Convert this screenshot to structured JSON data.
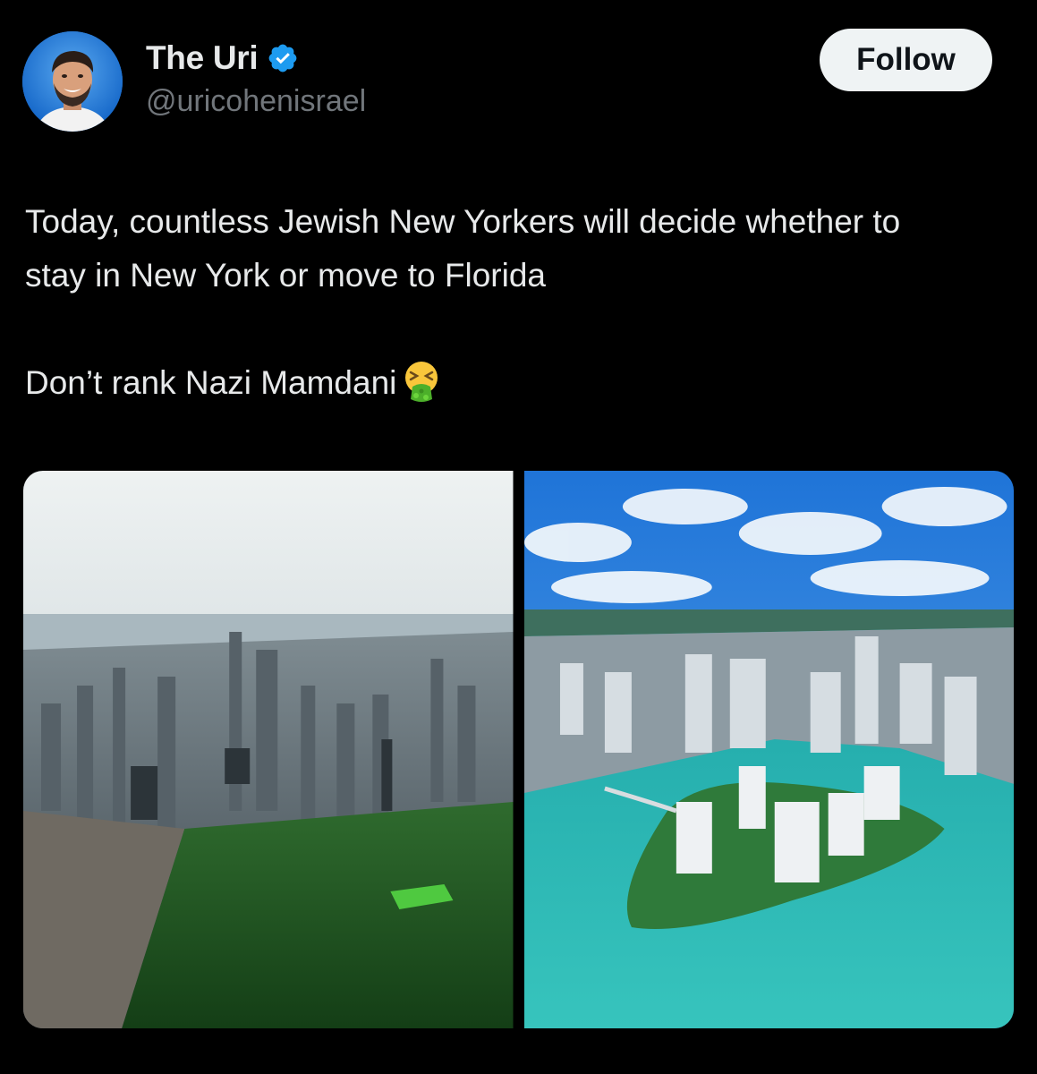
{
  "author": {
    "display_name": "The Uri",
    "handle": "@uricohenisrael",
    "verified": true,
    "avatar_icon": "avatar-icon"
  },
  "follow_label": "Follow",
  "tweet": {
    "line1": "Today, countless Jewish New Yorkers will decide whether to stay in New York or move to Florida",
    "line2": "Don’t rank Nazi Mamdani",
    "emoji": "nauseated-vomiting-face-icon"
  },
  "media": {
    "count": 2,
    "images": [
      "new-york-central-park-image",
      "miami-brickell-key-image"
    ]
  },
  "colors": {
    "background": "#000000",
    "text": "#e7e9ea",
    "secondary": "#71767b",
    "verified": "#1d9bf0",
    "follow_bg": "#eff3f4"
  }
}
